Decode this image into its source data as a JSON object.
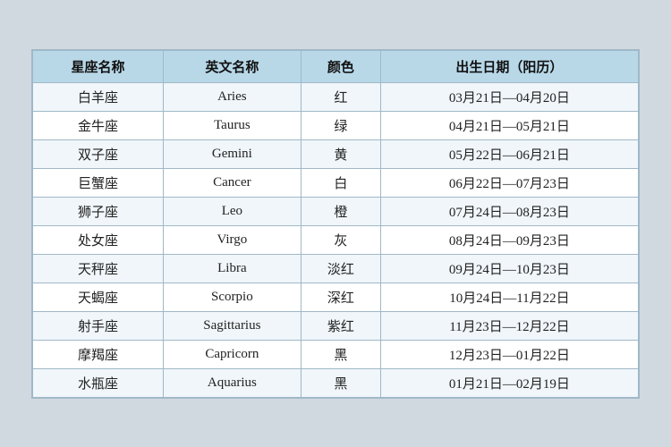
{
  "table": {
    "headers": [
      "星座名称",
      "英文名称",
      "颜色",
      "出生日期（阳历）"
    ],
    "rows": [
      [
        "白羊座",
        "Aries",
        "红",
        "03月21日—04月20日"
      ],
      [
        "金牛座",
        "Taurus",
        "绿",
        "04月21日—05月21日"
      ],
      [
        "双子座",
        "Gemini",
        "黄",
        "05月22日—06月21日"
      ],
      [
        "巨蟹座",
        "Cancer",
        "白",
        "06月22日—07月23日"
      ],
      [
        "狮子座",
        "Leo",
        "橙",
        "07月24日—08月23日"
      ],
      [
        "处女座",
        "Virgo",
        "灰",
        "08月24日—09月23日"
      ],
      [
        "天秤座",
        "Libra",
        "淡红",
        "09月24日—10月23日"
      ],
      [
        "天蝎座",
        "Scorpio",
        "深红",
        "10月24日—11月22日"
      ],
      [
        "射手座",
        "Sagittarius",
        "紫红",
        "11月23日—12月22日"
      ],
      [
        "摩羯座",
        "Capricorn",
        "黑",
        "12月23日—01月22日"
      ],
      [
        "水瓶座",
        "Aquarius",
        "黑",
        "01月21日—02月19日"
      ]
    ]
  }
}
